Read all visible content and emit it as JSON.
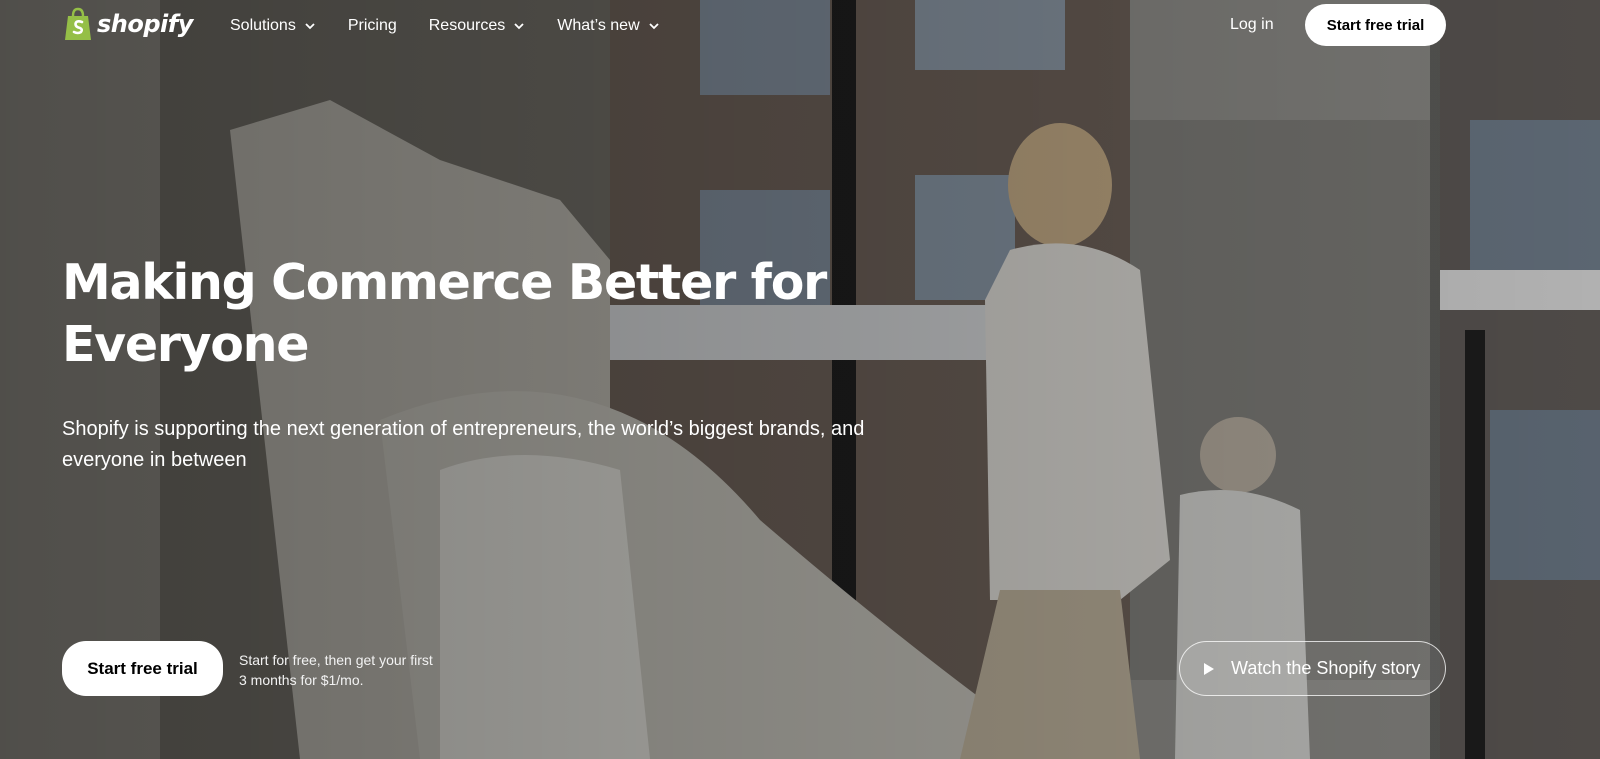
{
  "brand": {
    "name": "shopify",
    "logo_icon": "shopping-bag-icon",
    "accent_color": "#95bf47"
  },
  "nav": {
    "items": [
      {
        "label": "Solutions",
        "icon": "chevron-down-icon"
      },
      {
        "label": "Pricing"
      },
      {
        "label": "Resources",
        "icon": "chevron-down-icon"
      },
      {
        "label": "What’s new",
        "icon": "chevron-down-icon"
      }
    ],
    "login_label": "Log in",
    "cta_label": "Start free trial"
  },
  "hero": {
    "headline": "Making Commerce Better for Everyone",
    "subtext": "Shopify is supporting the next generation of entrepreneurs, the world’s biggest brands, and everyone in between",
    "cta_label": "Start free trial",
    "cta_note": "Start for free, then get your first 3 months for $1/mo.",
    "watch_label": "Watch the Shopify story",
    "watch_icon": "play-icon",
    "background_image": "bridal-boutique-photo"
  }
}
